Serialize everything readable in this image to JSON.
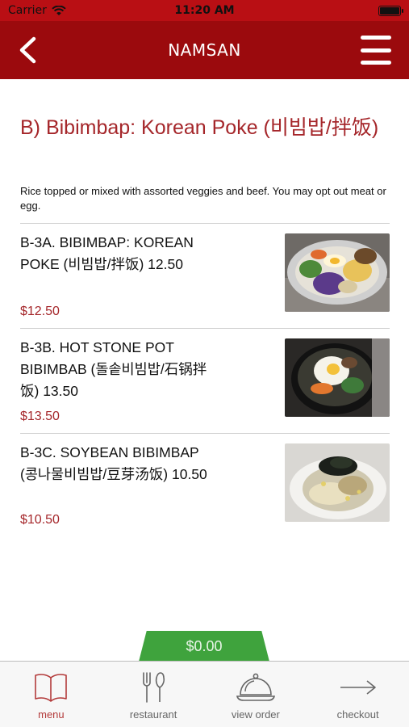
{
  "status": {
    "carrier": "Carrier",
    "time": "11:20 AM"
  },
  "nav": {
    "title": "NAMSAN"
  },
  "section": {
    "title": "B) Bibimbap: Korean Poke (비빔밥/拌饭)",
    "description": "Rice topped or mixed with assorted veggies and beef. You may opt out meat or egg."
  },
  "items": [
    {
      "name": "B-3A. BIBIMBAP: KOREAN POKE (비빔밥/拌饭) 12.50",
      "price": "$12.50"
    },
    {
      "name": "B-3B. HOT STONE POT BIBIMBAB (돌솥비빔밥/石锅拌饭) 13.50",
      "price": "$13.50"
    },
    {
      "name": "B-3C. SOYBEAN BIBIMBAP (콩나물비빔밥/豆芽汤饭) 10.50",
      "price": "$10.50"
    }
  ],
  "cart": {
    "total": "$0.00"
  },
  "tabs": [
    {
      "label": "menu",
      "icon": "book-icon",
      "active": true
    },
    {
      "label": "restaurant",
      "icon": "fork-knife-icon",
      "active": false
    },
    {
      "label": "view order",
      "icon": "cloche-icon",
      "active": false
    },
    {
      "label": "checkout",
      "icon": "arrow-right-icon",
      "active": false
    }
  ],
  "colors": {
    "header": "#9b0a0d",
    "status_bar": "#b90f14",
    "accent_text": "#a5262a",
    "cart": "#3fa33d"
  }
}
